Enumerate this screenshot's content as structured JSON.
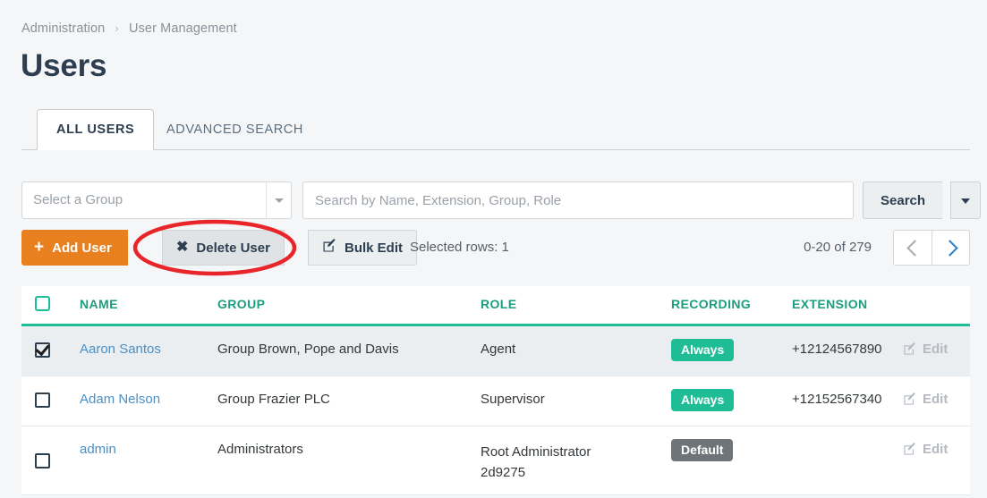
{
  "breadcrumb": {
    "items": [
      "Administration",
      "User Management"
    ],
    "separator": "›"
  },
  "page": {
    "title": "Users"
  },
  "tabs": [
    {
      "label": "ALL USERS",
      "active": true
    },
    {
      "label": "ADVANCED SEARCH",
      "active": false
    }
  ],
  "filters": {
    "group_select_placeholder": "Select a Group",
    "group_select_value": "",
    "search_placeholder": "Search by Name, Extension, Group, Role",
    "search_value": "",
    "search_button_label": "Search"
  },
  "toolbar": {
    "add_user_label": "Add User",
    "add_user_icon": "plus-icon",
    "delete_user_label": "Delete User",
    "delete_user_icon": "cross-icon",
    "bulk_edit_label": "Bulk Edit",
    "bulk_edit_icon": "pencil-square-icon",
    "selected_rows_label": "Selected rows: 1",
    "pagination_label": "0-20 of 279"
  },
  "table": {
    "headers": [
      "NAME",
      "GROUP",
      "ROLE",
      "RECORDING",
      "EXTENSION"
    ],
    "rows": [
      {
        "checked": true,
        "name": "Aaron Santos",
        "group": "Group Brown, Pope and Davis",
        "role": "Agent",
        "recording": "Always",
        "recording_style": "always",
        "extension": "+12124567890",
        "edit_label": "Edit"
      },
      {
        "checked": false,
        "name": "Adam Nelson",
        "group": "Group Frazier PLC",
        "role": "Supervisor",
        "recording": "Always",
        "recording_style": "always",
        "extension": "+12152567340",
        "edit_label": "Edit"
      },
      {
        "checked": false,
        "name": "admin",
        "group": "Administrators",
        "role": "Root Administrator 2d9275",
        "recording": "Default",
        "recording_style": "default",
        "extension": "",
        "edit_label": "Edit"
      }
    ]
  },
  "annotation": {
    "shape": "ellipse-highlight",
    "color": "#e8262a",
    "target": "delete-user-button"
  },
  "colors": {
    "accent_teal": "#1fbd96",
    "accent_orange": "#e8801f",
    "link_blue": "#4a90c7",
    "title_navy": "#2c3e50",
    "badge_default_gray": "#6e7478"
  }
}
